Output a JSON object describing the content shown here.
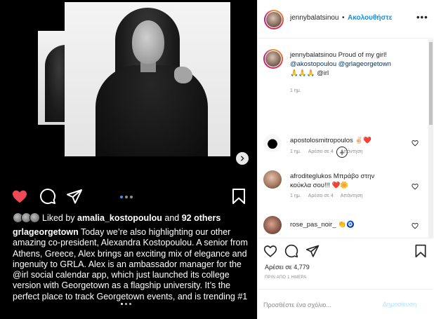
{
  "post": {
    "liked_by_prefix": "Liked by",
    "liked_by_user": "amalia_kostopoulou",
    "liked_by_and": "and",
    "liked_by_others": "92 others",
    "caption_user": "grlageorgetown",
    "caption_text": " Today we’re also highlighting our other amazing co-president, Alexandra Kostopoulou. A senior from Athens, Greece, Alex brings an exciting mix of elegance and ingenuity to GRLA. Alex is an ambassador manager for the @irl social calendar app, which just launched its college version with Georgetown as a flagship university. It’s the perfect place to track Georgetown events, and is trending #1",
    "carousel_count": 3,
    "carousel_active": 0
  },
  "header": {
    "username": "jennybalatsinou",
    "separator": "•",
    "follow_label": "Ακολουθήστε",
    "more_label": "•••"
  },
  "owner_comment": {
    "username": "jennybalatsinou",
    "text": " Proud of my girl!",
    "mentions": "@akostopoulou @grlageorgetown",
    "line3": "🙏🙏🙏 @irl",
    "time": "1 ημ."
  },
  "comments": [
    {
      "username": "apostolosmitropoulos",
      "text": " ✌🏻❤️",
      "time": "1 ημ.",
      "likes": "Αρέσει σε 4",
      "reply": "Απάντηση"
    },
    {
      "username": "afroditeglukos",
      "text": " Μπράβο στην κούκλα σου!!! ❤️🌼",
      "time": "1 ημ.",
      "likes": "Αρέσει σε 4",
      "reply": "Απάντηση"
    },
    {
      "username": "rose_pas_noir_",
      "text": " 👏🧿",
      "time": "",
      "likes": "",
      "reply": ""
    }
  ],
  "stats": {
    "likes_label": "Αρέσει σε 4,779",
    "time_ago": "ΠΡΙΝ ΑΠΟ 1 ΗΜΕΡΑ"
  },
  "comment_box": {
    "placeholder": "Προσθέστε ένα σχόλιο...",
    "post_label": "Δημοσίευση"
  },
  "colors": {
    "like_red": "#ed4956",
    "link_blue": "#0095f6",
    "post_btn_disabled": "#b2dffc"
  }
}
